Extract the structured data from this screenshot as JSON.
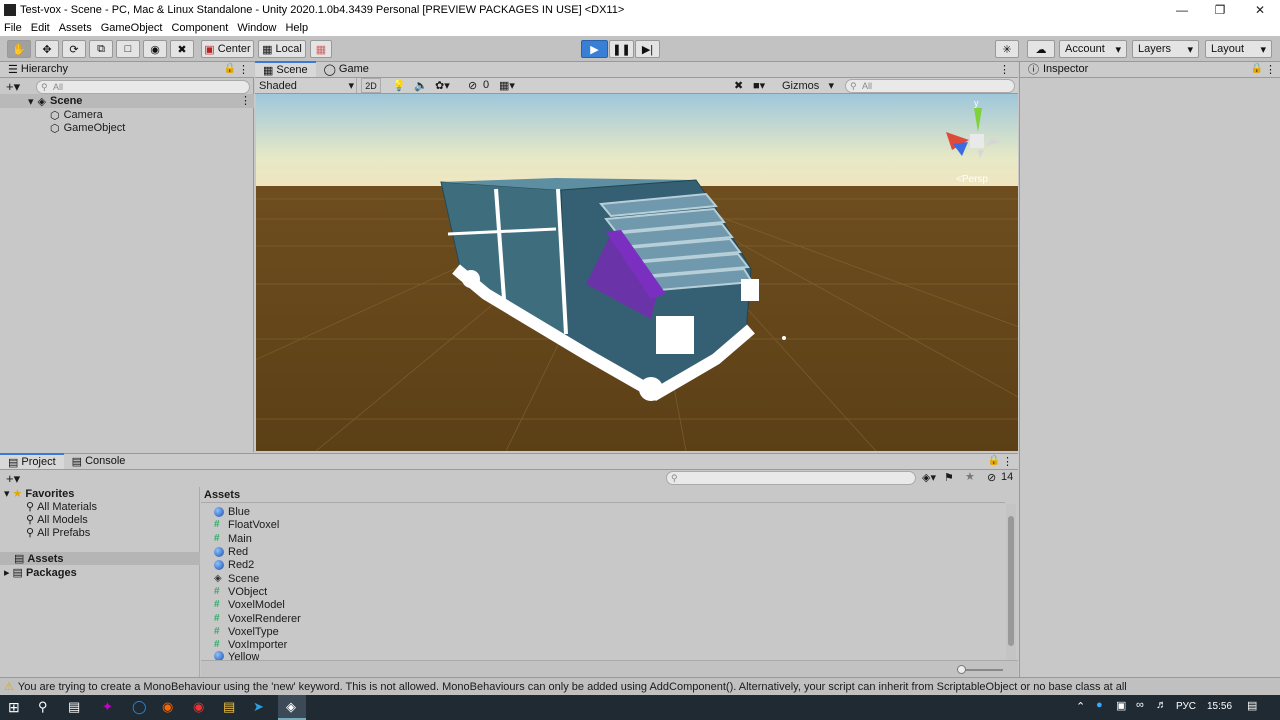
{
  "window": {
    "title": "Test-vox - Scene - PC, Mac & Linux Standalone - Unity 2020.1.0b4.3439 Personal [PREVIEW PACKAGES IN USE] <DX11>"
  },
  "menu": [
    "File",
    "Edit",
    "Assets",
    "GameObject",
    "Component",
    "Window",
    "Help"
  ],
  "toolbar": {
    "pivot_label": "Center",
    "space_label": "Local",
    "account_label": "Account",
    "layers_label": "Layers",
    "layout_label": "Layout"
  },
  "hierarchy": {
    "tab": "Hierarchy",
    "search_placeholder": "All",
    "scene": "Scene",
    "items": [
      "Camera",
      "GameObject"
    ]
  },
  "scene_view": {
    "tabs": [
      "Scene",
      "Game"
    ],
    "shading_mode": "Shaded",
    "mode_2d": "2D",
    "hidden_count": "0",
    "gizmos_label": "Gizmos",
    "search_placeholder": "All",
    "persp_label": "<Persp",
    "gizmo_axis_y": "y",
    "sky_color": "#e7e9c6",
    "ground_color": "#5b3f16"
  },
  "inspector": {
    "tab": "Inspector"
  },
  "project": {
    "tabs": [
      "Project",
      "Console"
    ],
    "hidden_count": "14",
    "favorites_label": "Favorites",
    "favorites": [
      "All Materials",
      "All Models",
      "All Prefabs"
    ],
    "roots": [
      "Assets",
      "Packages"
    ],
    "assets_header": "Assets",
    "assets": [
      {
        "name": "Blue",
        "icon": "material-sphere-icon"
      },
      {
        "name": "FloatVoxel",
        "icon": "script-icon"
      },
      {
        "name": "Main",
        "icon": "script-icon"
      },
      {
        "name": "Red",
        "icon": "material-sphere-icon"
      },
      {
        "name": "Red2",
        "icon": "material-sphere-icon"
      },
      {
        "name": "Scene",
        "icon": "unity-scene-icon"
      },
      {
        "name": "VObject",
        "icon": "script-icon"
      },
      {
        "name": "VoxelModel",
        "icon": "script-icon"
      },
      {
        "name": "VoxelRenderer",
        "icon": "script-icon"
      },
      {
        "name": "VoxelType",
        "icon": "script-icon"
      },
      {
        "name": "VoxImporter",
        "icon": "script-icon"
      },
      {
        "name": "Yellow",
        "icon": "material-sphere-icon"
      }
    ]
  },
  "status": {
    "message": "You are trying to create a MonoBehaviour using the 'new' keyword.  This is not allowed.  MonoBehaviours can only be added using AddComponent(). Alternatively, your script can inherit from ScriptableObject or no base class at all"
  },
  "taskbar": {
    "language": "РУС",
    "time": "15:56"
  }
}
